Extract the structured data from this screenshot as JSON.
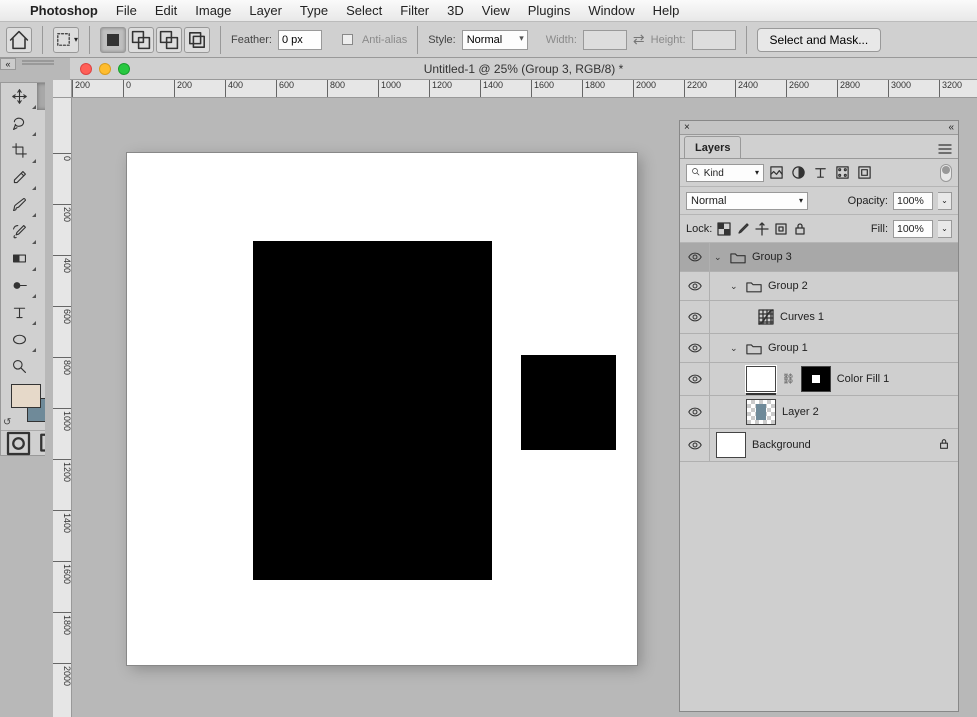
{
  "menubar": {
    "app": "Photoshop",
    "items": [
      "File",
      "Edit",
      "Image",
      "Layer",
      "Type",
      "Select",
      "Filter",
      "3D",
      "View",
      "Plugins",
      "Window",
      "Help"
    ]
  },
  "optionsbar": {
    "feather_label": "Feather:",
    "feather_value": "0 px",
    "antialias_label": "Anti-alias",
    "style_label": "Style:",
    "style_value": "Normal",
    "width_label": "Width:",
    "height_label": "Height:",
    "select_mask": "Select and Mask..."
  },
  "document": {
    "title": "Untitled-1 @ 25% (Group 3, RGB/8) *"
  },
  "ruler": {
    "h": [
      "200",
      "0",
      "200",
      "400",
      "600",
      "800",
      "1000",
      "1200",
      "1400",
      "1600",
      "1800",
      "2000",
      "2200",
      "2400",
      "2600",
      "2800",
      "3000",
      "3200"
    ],
    "v": [
      "0",
      "200",
      "400",
      "600",
      "800",
      "1000",
      "1200",
      "1400",
      "1600",
      "1800",
      "2000"
    ]
  },
  "layers_panel": {
    "title": "Layers",
    "filter_kind_label": "Kind",
    "blend_mode": "Normal",
    "opacity_label": "Opacity:",
    "opacity_value": "100%",
    "lock_label": "Lock:",
    "fill_label": "Fill:",
    "fill_value": "100%",
    "layers": [
      {
        "name": "Group 3"
      },
      {
        "name": "Group 2"
      },
      {
        "name": "Curves 1"
      },
      {
        "name": "Group 1"
      },
      {
        "name": "Color Fill 1"
      },
      {
        "name": "Layer 2"
      },
      {
        "name": "Background"
      }
    ]
  },
  "colors": {
    "foreground": "#e6d9c9",
    "background_swatch": "#6f8a99"
  }
}
